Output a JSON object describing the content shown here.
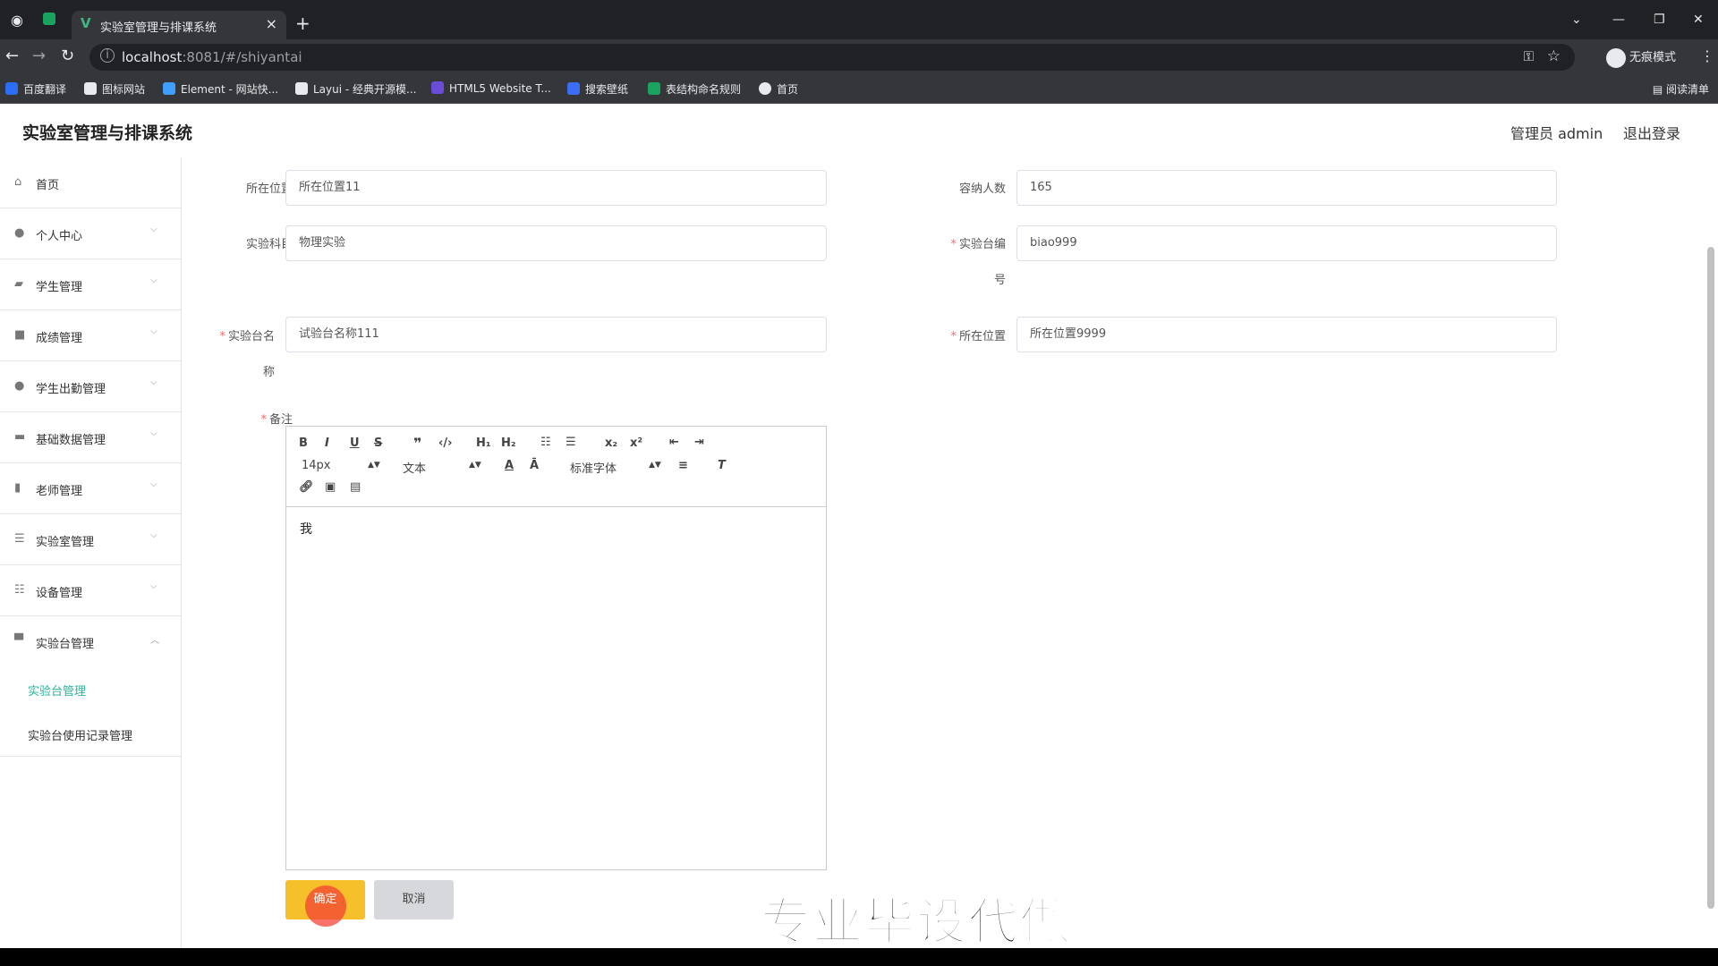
{
  "browser": {
    "tab_title": "实验室管理与排课系统",
    "tab_close": "×",
    "new_tab": "+",
    "url_host": "localhost",
    "url_path": ":8081/#/shiyantai",
    "incognito_label": "无痕模式",
    "bookmarks": [
      {
        "label": "百度翻译",
        "color": "#2c6df5"
      },
      {
        "label": "图标网站",
        "color": "#e8eaed"
      },
      {
        "label": "Element - 网站快...",
        "color": "#409eff"
      },
      {
        "label": "Layui - 经典开源模...",
        "color": "#e8eaed"
      },
      {
        "label": "HTML5 Website T...",
        "color": "#6a4cd6"
      },
      {
        "label": "搜索壁纸",
        "color": "#3b6df5"
      },
      {
        "label": "表结构命名规则",
        "color": "#1aa260"
      },
      {
        "label": "首页",
        "color": "#e8eaed"
      }
    ],
    "reading_list": "阅读清单"
  },
  "header": {
    "app_title": "实验室管理与排课系统",
    "user": "管理员 admin",
    "logout": "退出登录"
  },
  "sidebar": {
    "items": [
      {
        "label": "首页",
        "icon": "home-icon"
      },
      {
        "label": "个人中心",
        "icon": "user-icon"
      },
      {
        "label": "学生管理",
        "icon": "student-icon"
      },
      {
        "label": "成绩管理",
        "icon": "grade-icon"
      },
      {
        "label": "学生出勤管理",
        "icon": "attendance-icon"
      },
      {
        "label": "基础数据管理",
        "icon": "data-icon"
      },
      {
        "label": "老师管理",
        "icon": "teacher-icon"
      },
      {
        "label": "实验室管理",
        "icon": "lab-icon"
      },
      {
        "label": "设备管理",
        "icon": "device-icon"
      },
      {
        "label": "实验台管理",
        "icon": "bench-icon"
      }
    ],
    "sub_items": [
      {
        "label": "实验台管理",
        "active": true
      },
      {
        "label": "实验台使用记录管理",
        "active": false
      }
    ]
  },
  "form": {
    "location_label": "所在位置",
    "location_value": "所在位置11",
    "capacity_label": "容纳人数",
    "capacity_value": "165",
    "subject_label": "实验科目",
    "subject_value": "物理实验",
    "bench_no_label_1": "实验台编",
    "bench_no_label_2": "号",
    "bench_no_value": "biao999",
    "bench_name_label_1": "实验台名",
    "bench_name_label_2": "称",
    "bench_name_value": "试验台名称111",
    "bench_location_label": "所在位置",
    "bench_location_value": "所在位置9999",
    "remark_label": "备注",
    "required_mark": "*"
  },
  "editor": {
    "size_select": "14px",
    "format_select": "文本",
    "font_select": "标准字体",
    "content": "我"
  },
  "buttons": {
    "ok": "确定",
    "cancel": "取消"
  },
  "watermark": "专业毕设代做",
  "colors": {
    "accent": "#2bb39b",
    "ok_button": "#f5c02a",
    "required": "#f56c6c"
  }
}
